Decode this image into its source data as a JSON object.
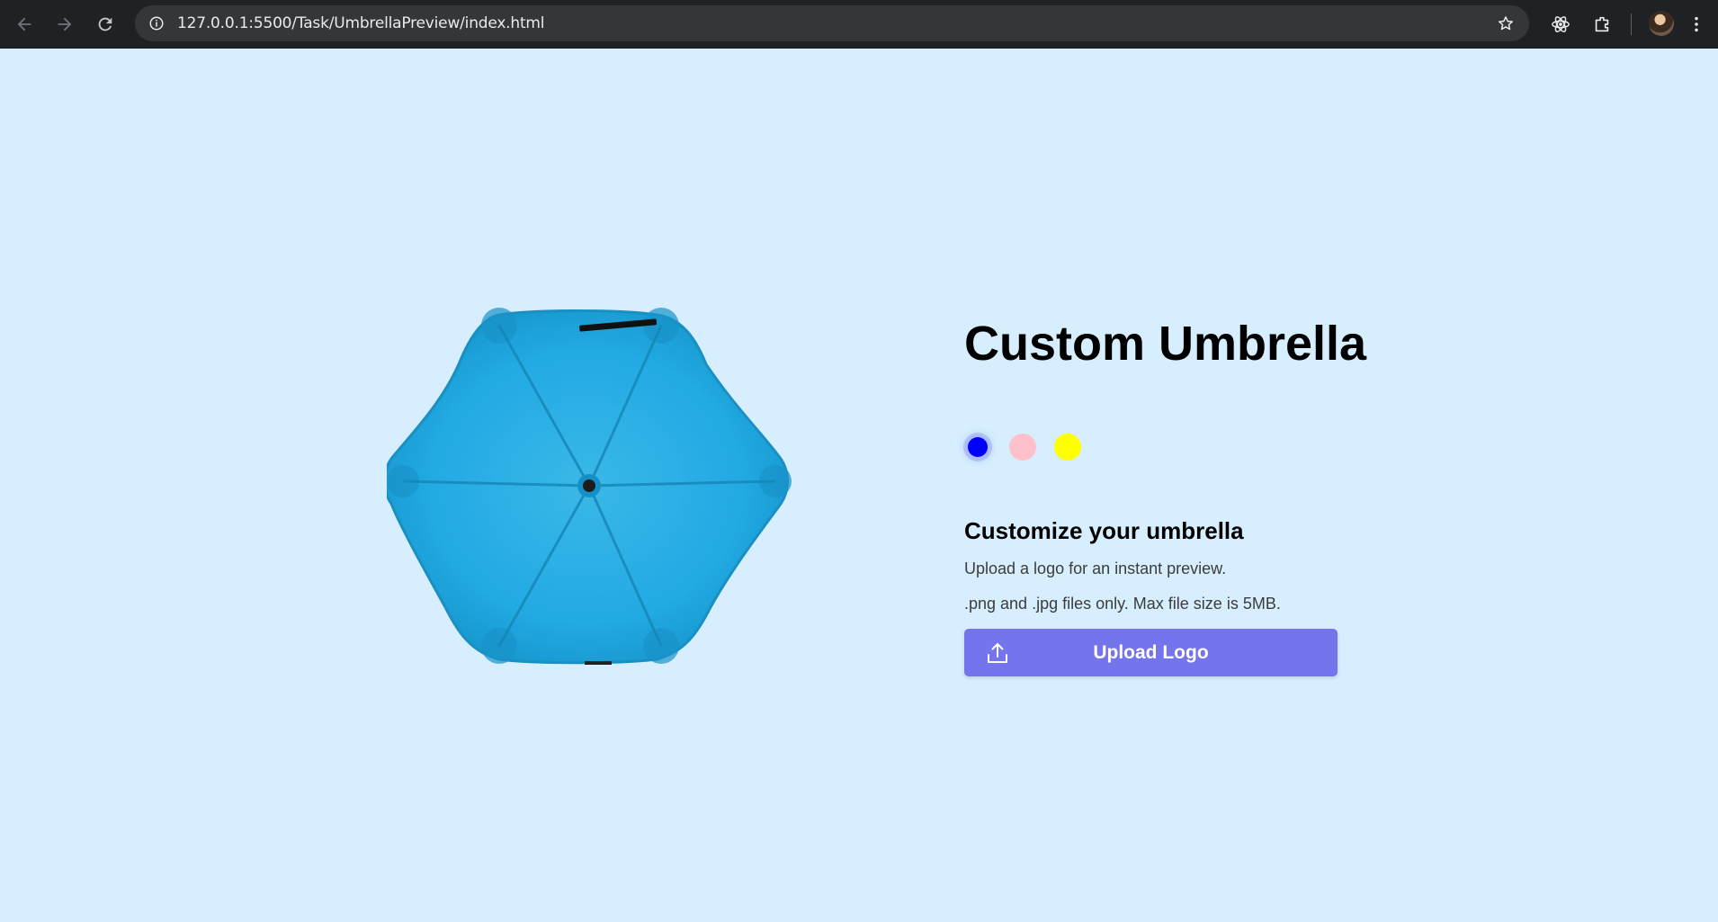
{
  "browser": {
    "url": "127.0.0.1:5500/Task/UmbrellaPreview/index.html",
    "icons": [
      "back-icon",
      "forward-icon",
      "reload-icon",
      "site-info-icon",
      "bookmark-star-icon",
      "react-devtools-icon",
      "extensions-icon",
      "profile-avatar",
      "menu-icon"
    ]
  },
  "product": {
    "title": "Custom Umbrella",
    "umbrella_color": "#1ea7e1",
    "swatches": [
      {
        "name": "blue",
        "color": "#0000ff",
        "selected": true
      },
      {
        "name": "pink",
        "color": "#ffc0cb",
        "selected": false
      },
      {
        "name": "yellow",
        "color": "#ffff00",
        "selected": false
      }
    ]
  },
  "customize": {
    "heading": "Customize your umbrella",
    "line1": "Upload a logo for an instant preview.",
    "line2": ".png and .jpg files only. Max file size is 5MB.",
    "button_label": "Upload Logo",
    "button_color": "#7474ec"
  },
  "colors": {
    "page_background": "#d6eefd",
    "chrome_background": "#202124"
  }
}
